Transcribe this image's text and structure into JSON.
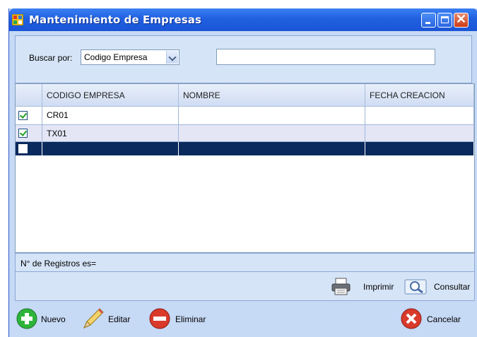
{
  "window": {
    "title": "Mantenimiento de Empresas",
    "minimize_icon": "minimize-icon",
    "maximize_icon": "maximize-icon",
    "close_glyph": "✕"
  },
  "search": {
    "label": "Buscar por:",
    "field_selected": "Codigo Empresa",
    "query_value": ""
  },
  "grid": {
    "columns": [
      "",
      "CODIGO EMPRESA",
      "NOMBRE",
      "FECHA CREACION"
    ],
    "rows": [
      {
        "checked": true,
        "codigo": "CR01",
        "nombre": "",
        "fecha": "",
        "selected": false
      },
      {
        "checked": true,
        "codigo": "TX01",
        "nombre": "",
        "fecha": "",
        "selected": false
      },
      {
        "checked": false,
        "codigo": "",
        "nombre": "",
        "fecha": "",
        "selected": true
      }
    ]
  },
  "status": {
    "count_label": "N° de Registros es="
  },
  "actions": {
    "print_label": "Imprimir",
    "consult_label": "Consultar"
  },
  "buttons": {
    "new_label": "Nuevo",
    "edit_label": "Editar",
    "delete_label": "Eliminar",
    "cancel_label": "Cancelar"
  },
  "colors": {
    "titlebar": "#2060e0",
    "form_background": "#c6d9f5",
    "selected_row": "#0a2a5e",
    "alt_row": "#e4e6f6",
    "check_mark": "#21a121"
  }
}
